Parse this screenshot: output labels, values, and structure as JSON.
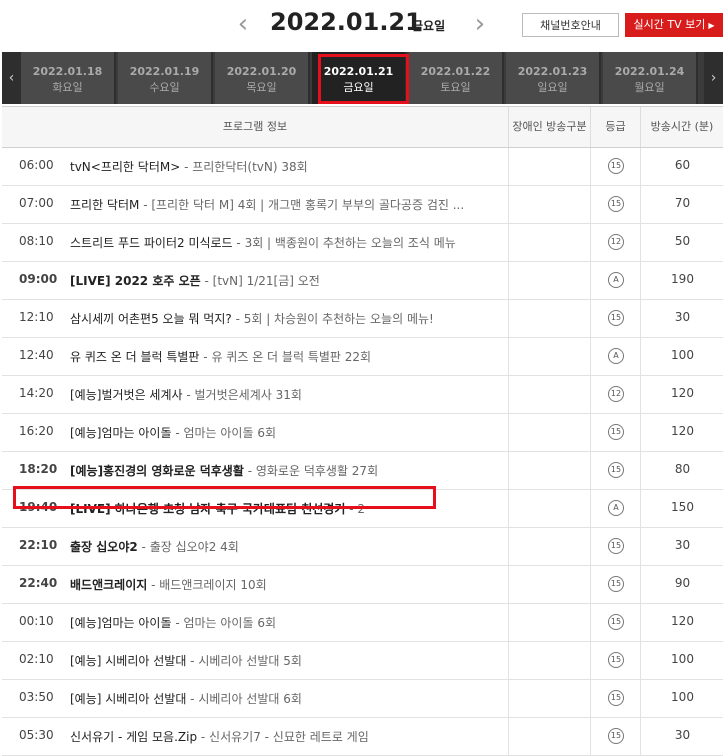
{
  "header": {
    "date": "2022.01.21",
    "day": "금요일",
    "prev_icon": "chevron-left-icon",
    "next_icon": "chevron-right-icon",
    "channel_button": "채널번호안내",
    "live_button": "실시간 TV 보기",
    "live_icon": "play-icon"
  },
  "days": [
    {
      "date": "2022.01.18",
      "day": "화요일"
    },
    {
      "date": "2022.01.19",
      "day": "수요일"
    },
    {
      "date": "2022.01.20",
      "day": "목요일"
    },
    {
      "date": "2022.01.21",
      "day": "금요일",
      "active": true
    },
    {
      "date": "2022.01.22",
      "day": "토요일"
    },
    {
      "date": "2022.01.23",
      "day": "일요일"
    },
    {
      "date": "2022.01.24",
      "day": "월요일"
    }
  ],
  "columns": [
    "프로그램 정보",
    "장애인 방송구분",
    "등급",
    "방송시간 (분)"
  ],
  "programs": [
    {
      "time": "06:00",
      "title": "tvN<프리한 닥터M>",
      "sub": " - 프리한닥터(tvN) 38회",
      "rating": "15",
      "duration": "60",
      "bold": false
    },
    {
      "time": "07:00",
      "title": "프리한 닥터M",
      "sub": " - [프리한 닥터 M] 4회 | 개그맨 홍록기 부부의 골다공증 검진 ...",
      "rating": "15",
      "duration": "70",
      "bold": false
    },
    {
      "time": "08:10",
      "title": "스트리트 푸드 파이터2 미식로드",
      "sub": " - 3회 | 백종원이 추천하는 오늘의 조식 메뉴",
      "rating": "12",
      "duration": "50",
      "bold": false
    },
    {
      "time": "09:00",
      "title": "[LIVE] 2022 호주 오픈",
      "sub": " - [tvN] 1/21[금] 오전",
      "rating": "A",
      "duration": "190",
      "bold": true
    },
    {
      "time": "12:10",
      "title": "삼시세끼 어촌편5 오늘 뭐 먹지?",
      "sub": " - 5회 | 차승원이 추천하는 오늘의 메뉴!",
      "rating": "15",
      "duration": "30",
      "bold": false
    },
    {
      "time": "12:40",
      "title": "유 퀴즈 온 더 블럭 특별판",
      "sub": " - 유 퀴즈 온 더 블럭 특별판 22회",
      "rating": "A",
      "duration": "100",
      "bold": false
    },
    {
      "time": "14:20",
      "title": "[예능]벌거벗은 세계사",
      "sub": " - 벌거벗은세계사 31회",
      "rating": "12",
      "duration": "120",
      "bold": false
    },
    {
      "time": "16:20",
      "title": "[예능]엄마는 아이돌",
      "sub": " - 엄마는 아이돌 6회",
      "rating": "15",
      "duration": "120",
      "bold": false
    },
    {
      "time": "18:20",
      "title": "[예능]홍진경의 영화로운 덕후생활",
      "sub": " - 영화로운 덕후생활 27회",
      "rating": "15",
      "duration": "80",
      "bold": true
    },
    {
      "time": "19:40",
      "title": "[LIVE] 하나은행 초청 남자 축구 국가대표팀 친선경기",
      "sub": " - 2",
      "rating": "A",
      "duration": "150",
      "bold": true
    },
    {
      "time": "22:10",
      "title": "출장 십오야2",
      "sub": " - 출장 십오야2 4회",
      "rating": "15",
      "duration": "30",
      "bold": true
    },
    {
      "time": "22:40",
      "title": "배드앤크레이지",
      "sub": " - 배드앤크레이지 10회",
      "rating": "15",
      "duration": "90",
      "bold": true
    },
    {
      "time": "00:10",
      "title": "[예능]엄마는 아이돌",
      "sub": " - 엄마는 아이돌 6회",
      "rating": "15",
      "duration": "120",
      "bold": false
    },
    {
      "time": "02:10",
      "title": "[예능] 시베리아 선발대",
      "sub": " - 시베리아 선발대 5회",
      "rating": "15",
      "duration": "100",
      "bold": false
    },
    {
      "time": "03:50",
      "title": "[예능] 시베리아 선발대",
      "sub": " - 시베리아 선발대 6회",
      "rating": "15",
      "duration": "100",
      "bold": false
    },
    {
      "time": "05:30",
      "title": "신서유기 - 게임 모음.Zip",
      "sub": " - 신서유기7 - 신묘한 레트로 게임",
      "rating": "15",
      "duration": "30",
      "bold": false
    }
  ],
  "colors": {
    "accent": "#d81c1c",
    "highlight": "#e5101b",
    "tabs_bg": "#3b3b3b"
  }
}
